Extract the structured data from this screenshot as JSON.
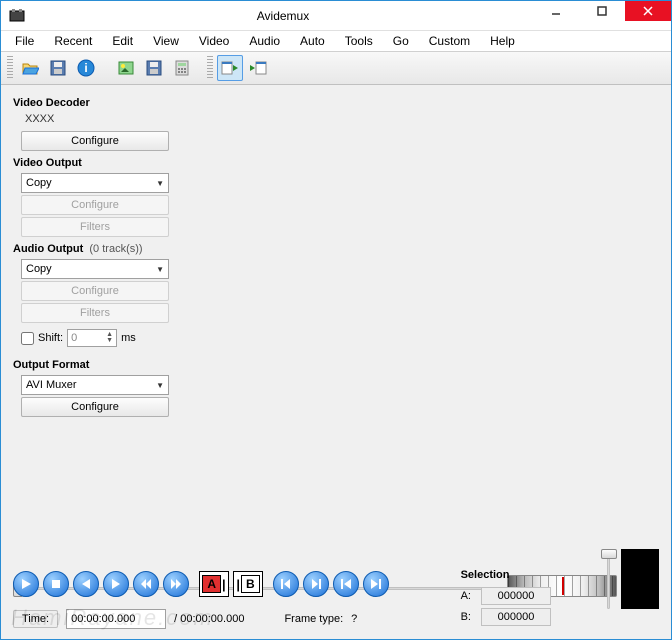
{
  "window": {
    "title": "Avidemux"
  },
  "menu": {
    "items": [
      "File",
      "Recent",
      "Edit",
      "View",
      "Video",
      "Audio",
      "Auto",
      "Tools",
      "Go",
      "Custom",
      "Help"
    ]
  },
  "toolbar": {
    "icons": [
      "open-icon",
      "save-icon",
      "info-icon",
      "image-icon",
      "save-media-icon",
      "calculator-icon",
      "play-input-icon",
      "play-output-icon"
    ]
  },
  "video_decoder": {
    "label": "Video Decoder",
    "value": "XXXX",
    "configure": "Configure"
  },
  "video_output": {
    "label": "Video Output",
    "value": "Copy",
    "configure": "Configure",
    "filters": "Filters"
  },
  "audio_output": {
    "label": "Audio Output",
    "sub": "(0 track(s))",
    "value": "Copy",
    "configure": "Configure",
    "filters": "Filters",
    "shift_label": "Shift:",
    "shift_value": "0",
    "shift_unit": "ms"
  },
  "output_format": {
    "label": "Output Format",
    "value": "AVI Muxer",
    "configure": "Configure"
  },
  "playback": {
    "buttons": [
      "play",
      "stop",
      "prev",
      "next",
      "rewind",
      "forward",
      "mark-a",
      "mark-b",
      "goto-a",
      "goto-b",
      "prev-black",
      "next-black"
    ]
  },
  "time": {
    "label": "Time:",
    "value": "00:00:00.000",
    "total": "/ 00:00:00.000",
    "frame_type_label": "Frame type:",
    "frame_type_value": "?"
  },
  "selection": {
    "label": "Selection",
    "a_label": "A:",
    "a_value": "000000",
    "b_label": "B:",
    "b_value": "000000"
  },
  "watermark": "HamiRayane.com"
}
